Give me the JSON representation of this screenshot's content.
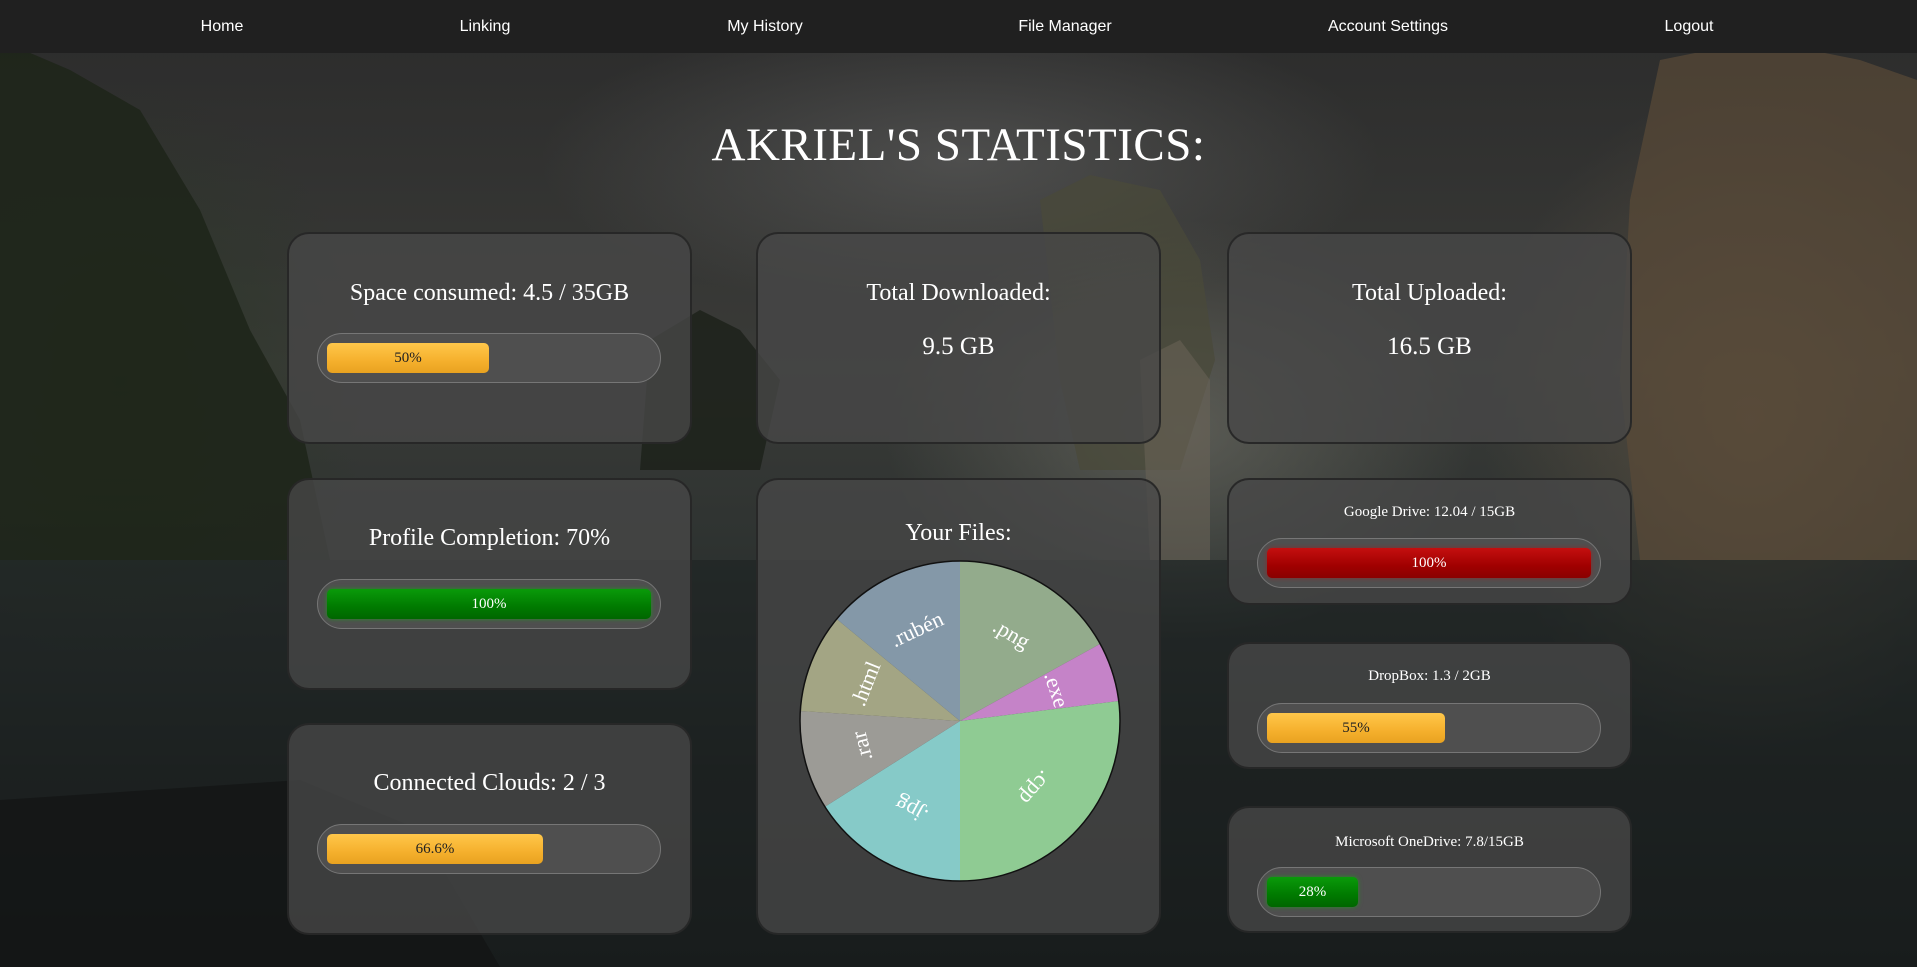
{
  "nav": {
    "items": [
      {
        "label": "Home"
      },
      {
        "label": "Linking"
      },
      {
        "label": "My History"
      },
      {
        "label": "File Manager"
      },
      {
        "label": "Account Settings"
      },
      {
        "label": "Logout"
      }
    ]
  },
  "page_title": "AKRIEL'S STATISTICS:",
  "space": {
    "label": "Space consumed: 4.5 / 35GB",
    "percent_text": "50%",
    "fill_fraction": 0.5,
    "color": "#f5b02d"
  },
  "profile": {
    "label": "Profile Completion: 70%",
    "percent_text": "100%",
    "fill_fraction": 1.0,
    "color": "#007a00"
  },
  "clouds": {
    "label": "Connected Clouds: 2 / 3",
    "percent_text": "66.6%",
    "fill_fraction": 0.666,
    "color": "#f5b02d"
  },
  "downloaded": {
    "label": "Total Downloaded:",
    "value": "9.5 GB"
  },
  "uploaded": {
    "label": "Total Uploaded:",
    "value": "16.5 GB"
  },
  "files": {
    "label": "Your Files:"
  },
  "google": {
    "label": "Google Drive: 12.04 / 15GB",
    "percent_text": "100%",
    "fill_fraction": 1.0,
    "color": "#a00000"
  },
  "dropbox": {
    "label": "DropBox: 1.3 / 2GB",
    "percent_text": "55%",
    "fill_fraction": 0.55,
    "color": "#f5b02d"
  },
  "onedrive": {
    "label": "Microsoft OneDrive: 7.8/15GB",
    "percent_text": "28%",
    "fill_fraction": 0.28,
    "color": "#007a00"
  },
  "chart_data": {
    "type": "pie",
    "title": "Your Files:",
    "labels": [
      ".png",
      ".exe",
      ".cpp",
      ".jpg",
      ".rar",
      ".html",
      ".rubén"
    ],
    "values": [
      17,
      6,
      27,
      16,
      10,
      10,
      14
    ],
    "colors": [
      "#93ab8c",
      "#c583c8",
      "#8fcb93",
      "#86cac8",
      "#9c9b96",
      "#a3a584",
      "#8498a8"
    ]
  }
}
